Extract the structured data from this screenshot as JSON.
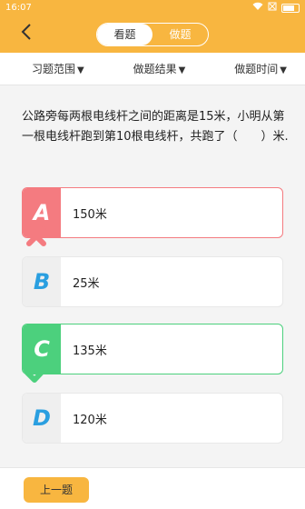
{
  "status": {
    "time": "16:07"
  },
  "header": {
    "tabs": [
      {
        "label": "看题",
        "active": true
      },
      {
        "label": "做题",
        "active": false
      }
    ]
  },
  "filters": [
    {
      "label": "习题范围"
    },
    {
      "label": "做题结果"
    },
    {
      "label": "做题时间"
    }
  ],
  "question": {
    "text": "公路旁每两根电线杆之间的距离是15米，小明从第一根电线杆跑到第10根电线杆，共跑了（　　）米."
  },
  "options": [
    {
      "letter": "A",
      "text": "150米",
      "state": "wrong"
    },
    {
      "letter": "B",
      "text": "25米",
      "state": "normal"
    },
    {
      "letter": "C",
      "text": "135米",
      "state": "right"
    },
    {
      "letter": "D",
      "text": "120米",
      "state": "normal"
    }
  ],
  "bottom": {
    "prev_label": "上一题"
  },
  "colors": {
    "accent": "#f8b640",
    "wrong": "#f47b80",
    "right": "#4cd07d",
    "letter_blue": "#2a9fe0"
  }
}
